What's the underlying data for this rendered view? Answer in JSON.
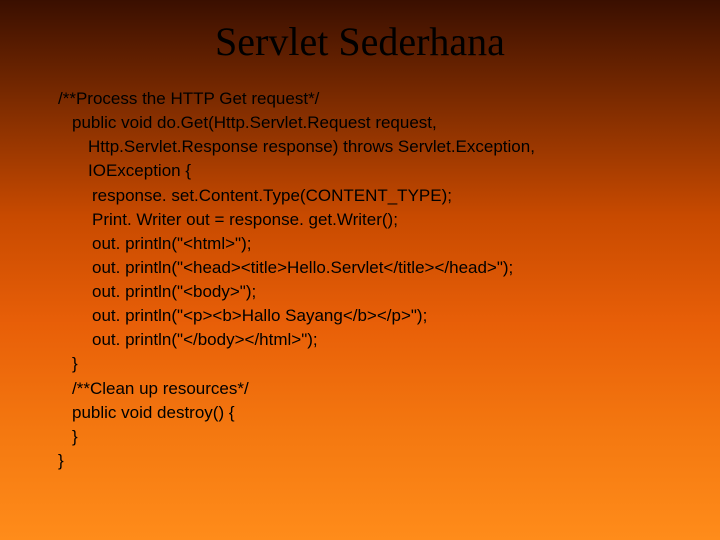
{
  "slide": {
    "title": "Servlet Sederhana",
    "code_lines": [
      {
        "text": "/**Process the HTTP Get request*/",
        "indent": "i1"
      },
      {
        "text": "public void do.Get(Http.Servlet.Request request,",
        "indent": "i2"
      },
      {
        "text": "Http.Servlet.Response response) throws Servlet.Exception,",
        "indent": "i3"
      },
      {
        "text": "IOException {",
        "indent": "i3"
      },
      {
        "text": "response. set.Content.Type(CONTENT_TYPE);",
        "indent": "i4"
      },
      {
        "text": "Print. Writer out = response. get.Writer();",
        "indent": "i4"
      },
      {
        "text": "out. println(\"<html>\");",
        "indent": "i4"
      },
      {
        "text": "out. println(\"<head><title>Hello.Servlet</title></head>\");",
        "indent": "i4"
      },
      {
        "text": "out. println(\"<body>\");",
        "indent": "i4"
      },
      {
        "text": "out. println(\"<p><b>Hallo Sayang</b></p>\");",
        "indent": "i4"
      },
      {
        "text": "out. println(\"</body></html>\");",
        "indent": "i4"
      },
      {
        "text": "}",
        "indent": "i2"
      },
      {
        "text": "/**Clean up resources*/",
        "indent": "i2"
      },
      {
        "text": "public void destroy() {",
        "indent": "i2"
      },
      {
        "text": "}",
        "indent": "i2"
      },
      {
        "text": "}",
        "indent": "i1"
      }
    ]
  }
}
